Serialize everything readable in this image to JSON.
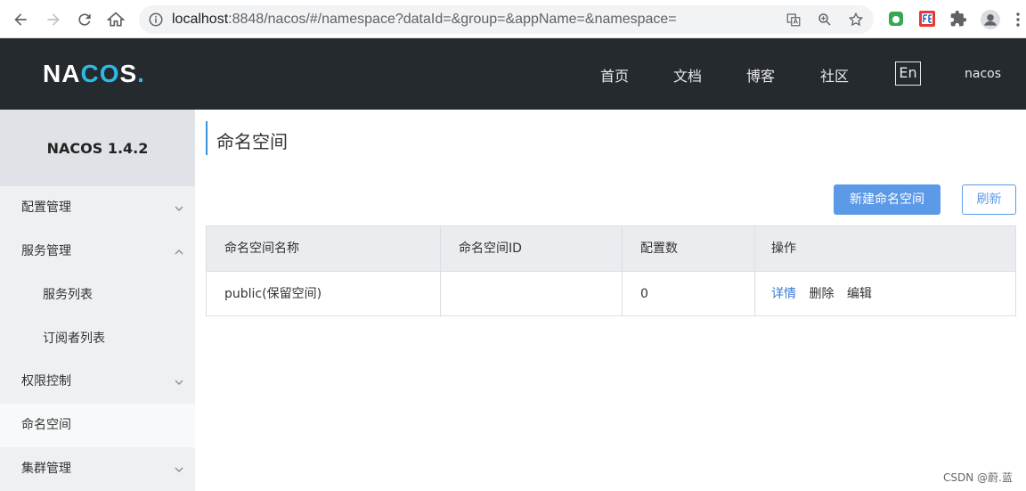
{
  "browser": {
    "url_host": "localhost",
    "url_path": ":8848/nacos/#/namespace?dataId=&group=&appName=&namespace="
  },
  "header": {
    "logo_pre": "NA",
    "logo_o1": "C",
    "logo_o2": "O",
    "logo_post": "S",
    "logo_dot": ".",
    "nav": [
      "首页",
      "文档",
      "博客",
      "社区"
    ],
    "lang": "En",
    "user": "nacos"
  },
  "sidebar": {
    "title": "NACOS 1.4.2",
    "items": [
      {
        "label": "配置管理"
      },
      {
        "label": "服务管理"
      },
      {
        "label": "服务列表"
      },
      {
        "label": "订阅者列表"
      },
      {
        "label": "权限控制"
      },
      {
        "label": "命名空间"
      },
      {
        "label": "集群管理"
      }
    ]
  },
  "main": {
    "title": "命名空间",
    "create_button": "新建命名空间",
    "refresh_button": "刷新",
    "table": {
      "columns": [
        "命名空间名称",
        "命名空间ID",
        "配置数",
        "操作"
      ],
      "rows": [
        {
          "name": "public(保留空间)",
          "id": "",
          "count": "0",
          "ops": [
            "详情",
            "删除",
            "编辑"
          ]
        }
      ]
    }
  },
  "watermark": "CSDN @蔚.蓝",
  "colors": {
    "header_bg": "#252a2f",
    "accent": "#5c9ae8",
    "link": "#3a7bd5"
  }
}
